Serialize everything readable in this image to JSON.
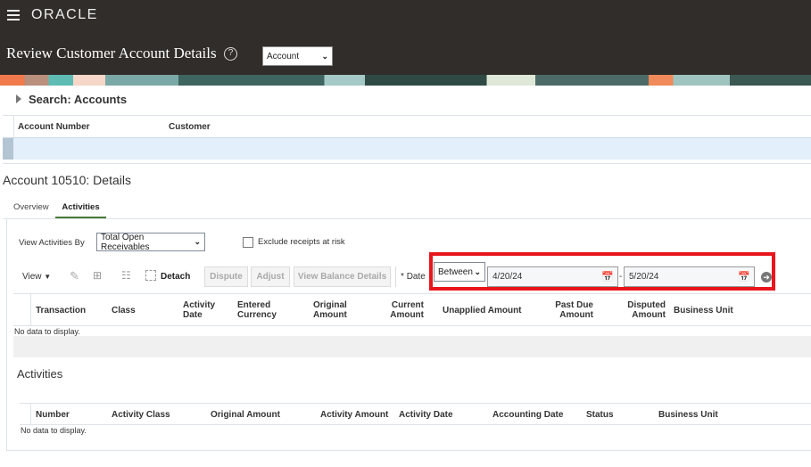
{
  "header": {
    "brand": "ORACLE",
    "title": "Review Customer Account Details",
    "help_icon": "?",
    "view_select": "Account"
  },
  "search": {
    "title": "Search: Accounts",
    "columns": [
      "Account Number",
      "Customer"
    ]
  },
  "details": {
    "title": "Account 10510: Details",
    "tabs": [
      {
        "label": "Overview"
      },
      {
        "label": "Activities",
        "active": true
      }
    ]
  },
  "filters": {
    "view_by_label": "View Activities By",
    "view_by_value": "Total Open Receivables",
    "exclude_label": "Exclude receipts at risk",
    "exclude_checked": false
  },
  "toolbar": {
    "view": "View",
    "detach": "Detach",
    "dispute": "Dispute",
    "adjust": "Adjust",
    "view_balance": "View Balance Details",
    "date_label": "Date",
    "required": "*",
    "operator": "Between",
    "date_from": "4/20/24",
    "date_sep": "-",
    "date_to": "5/20/24"
  },
  "table1": {
    "columns": [
      "Transaction",
      "Class",
      "Activity Date",
      "Entered Currency",
      "Original Amount",
      "Current Amount",
      "Unapplied Amount",
      "Past Due Amount",
      "Disputed Amount",
      "Business Unit"
    ],
    "empty": "No data to display."
  },
  "activities": {
    "title": "Activities",
    "columns": [
      "Number",
      "Activity Class",
      "Original Amount",
      "Activity Amount",
      "Activity Date",
      "Accounting Date",
      "Status",
      "Business Unit"
    ],
    "empty": "No data to display."
  },
  "colors": {
    "header_bg": "#312d2a",
    "highlight": "#e3effb",
    "annotation": "#e8151d"
  }
}
